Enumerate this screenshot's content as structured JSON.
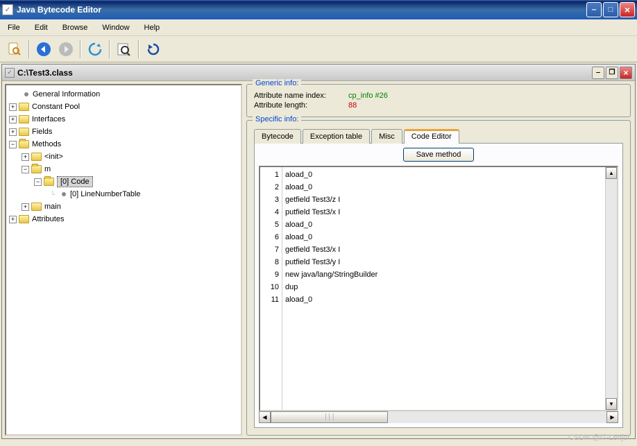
{
  "window": {
    "title": "Java Bytecode Editor"
  },
  "menu": {
    "file": "File",
    "edit": "Edit",
    "browse": "Browse",
    "window": "Window",
    "help": "Help"
  },
  "child": {
    "title": "C:\\Test3.class"
  },
  "tree": {
    "general": "General Information",
    "constantPool": "Constant Pool",
    "interfaces": "Interfaces",
    "fields": "Fields",
    "methods": "Methods",
    "init": "<init>",
    "m": "m",
    "code": "[0] Code",
    "lineNumberTable": "[0] LineNumberTable",
    "main": "main",
    "attributes": "Attributes"
  },
  "generic": {
    "title": "Generic info:",
    "attrNameLabel": "Attribute name index:",
    "attrNameValue": "cp_info #26",
    "attrLenLabel": "Attribute length:",
    "attrLenValue": "88"
  },
  "specific": {
    "title": "Specific info:",
    "tabs": {
      "bytecode": "Bytecode",
      "exception": "Exception table",
      "misc": "Misc",
      "codeEditor": "Code Editor"
    },
    "saveLabel": "Save method"
  },
  "code": {
    "lines": [
      "aload_0",
      "aload_0",
      "getfield Test3/z I",
      "putfield Test3/x I",
      "aload_0",
      "aload_0",
      "getfield Test3/x I",
      "putfield Test3/y I",
      "new java/lang/StringBuilder",
      "dup",
      "aload_0"
    ]
  },
  "watermark": "CSDN @IT-Lenjor"
}
